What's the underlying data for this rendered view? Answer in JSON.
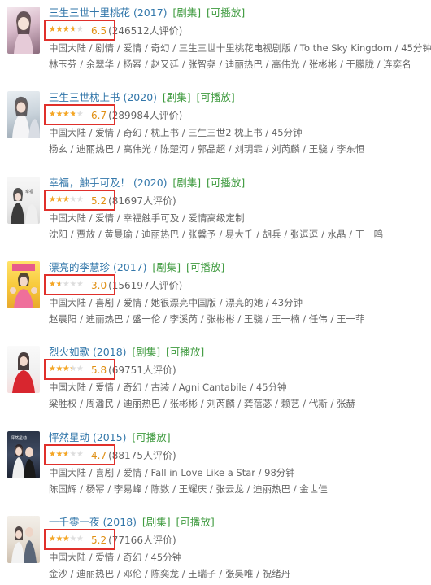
{
  "colors": {
    "title": "#3377aa",
    "tag": "#3e9a3e",
    "star": "#f5a623",
    "score": "#e09015",
    "highlight_box": "#e0302b"
  },
  "items": [
    {
      "title": "三生三世十里桃花 (2017)",
      "tags": [
        "[剧集]",
        "[可播放]"
      ],
      "rating_fraction": 0.65,
      "score": "6.5",
      "votes": "(246512人评价)",
      "meta1": "中国大陆 / 剧情 / 爱情 / 奇幻 / 三生三世十里桃花电视剧版 / To the Sky Kingdom / 45分钟",
      "meta2": "林玉芬 / 余翠华 / 杨幂 / 赵又廷 / 张智尧 / 迪丽热巴 / 高伟光 / 张彬彬 / 于朦胧 / 连奕名"
    },
    {
      "title": "三生三世枕上书 (2020)",
      "tags": [
        "[剧集]",
        "[可播放]"
      ],
      "rating_fraction": 0.67,
      "score": "6.7",
      "votes": "(289984人评价)",
      "meta1": "中国大陆 / 爱情 / 奇幻 / 枕上书 / 三生三世2 枕上书 / 45分钟",
      "meta2": "杨玄 / 迪丽热巴 / 高伟光 / 陈楚河 / 郭品超 / 刘玥霏 / 刘芮麟 / 王骁 / 李东恒"
    },
    {
      "title": "幸福，触手可及！ (2020)",
      "tags": [
        "[剧集]",
        "[可播放]"
      ],
      "rating_fraction": 0.52,
      "score": "5.2",
      "votes": "(81697人评价)",
      "meta1": "中国大陆 / 爱情 / 幸福触手可及 / 爱情高级定制",
      "meta2": "沈阳 / 贾放 / 黄曼瑜 / 迪丽热巴 / 张馨予 / 易大千 / 胡兵 / 张逗逗 / 水晶 / 王一鸣"
    },
    {
      "title": "漂亮的李慧珍 (2017)",
      "tags": [
        "[剧集]",
        "[可播放]"
      ],
      "rating_fraction": 0.3,
      "score": "3.0",
      "votes": "(156197人评价)",
      "meta1": "中国大陆 / 喜剧 / 爱情 / 她很漂亮中国版 / 漂亮的她 / 43分钟",
      "meta2": "赵晨阳 / 迪丽热巴 / 盛一伦 / 李溪芮 / 张彬彬 / 王骁 / 王一楠 / 任伟 / 王一菲"
    },
    {
      "title": "烈火如歌 (2018)",
      "tags": [
        "[剧集]",
        "[可播放]"
      ],
      "rating_fraction": 0.58,
      "score": "5.8",
      "votes": "(69751人评价)",
      "meta1": "中国大陆 / 爱情 / 奇幻 / 古装 / Agni Cantabile / 45分钟",
      "meta2": "梁胜权 / 周潘民 / 迪丽热巴 / 张彬彬 / 刘芮麟 / 龚蓓苾 / 赖艺 / 代斯 / 张赫"
    },
    {
      "title": "怦然星动 (2015)",
      "tags": [
        "[可播放]"
      ],
      "rating_fraction": 0.47,
      "score": "4.7",
      "votes": "(88175人评价)",
      "meta1": "中国大陆 / 喜剧 / 爱情 / Fall in Love Like a Star / 98分钟",
      "meta2": "陈国辉 / 杨幂 / 李易峰 / 陈数 / 王耀庆 / 张云龙 / 迪丽热巴 / 金世佳"
    },
    {
      "title": "一千零一夜 (2018)",
      "tags": [
        "[剧集]",
        "[可播放]"
      ],
      "rating_fraction": 0.52,
      "score": "5.2",
      "votes": "(77166人评价)",
      "meta1": "中国大陆 / 爱情 / 奇幻 / 45分钟",
      "meta2": "金沙 / 迪丽热巴 / 邓伦 / 陈奕龙 / 王瑞子 / 张昊唯 / 祝绪丹"
    }
  ]
}
